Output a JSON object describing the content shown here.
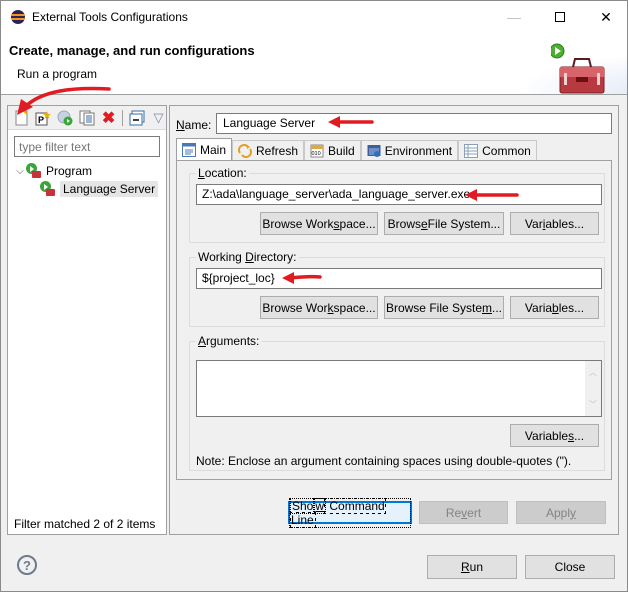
{
  "window": {
    "title": "External Tools Configurations",
    "controls": [
      "minimize",
      "maximize",
      "close"
    ]
  },
  "header": {
    "title": "Create, manage, and run configurations",
    "subtitle": "Run a program",
    "icon": "toolbox-run-icon"
  },
  "left_panel": {
    "toolbar": [
      {
        "name": "new-launch-configuration",
        "icon": "new-config-icon"
      },
      {
        "name": "new-prototype",
        "icon": "new-prototype-icon"
      },
      {
        "name": "export",
        "icon": "export-icon"
      },
      {
        "name": "duplicate",
        "icon": "duplicate-icon"
      },
      {
        "name": "delete",
        "icon": "delete-icon"
      },
      {
        "name": "collapse-all",
        "icon": "collapse-all-icon"
      },
      {
        "name": "filter",
        "icon": "filter-icon"
      }
    ],
    "filter_placeholder": "type filter text",
    "tree": {
      "category": "Program",
      "items": [
        "Language Server"
      ],
      "selected": "Language Server"
    },
    "status": "Filter matched 2 of 2 items"
  },
  "config": {
    "name_label_pre": "",
    "name_label_u": "N",
    "name_label_post": "ame:",
    "name_value": "Language Server",
    "tabs": [
      {
        "label": "Main",
        "icon": "main-tab-icon",
        "active": true
      },
      {
        "label": "Refresh",
        "icon": "refresh-icon",
        "active": false
      },
      {
        "label": "Build",
        "icon": "build-icon",
        "active": false
      },
      {
        "label": "Environment",
        "icon": "environment-icon",
        "active": false
      },
      {
        "label": "Common",
        "icon": "common-icon",
        "active": false
      }
    ],
    "location": {
      "label_u": "L",
      "label_post": "ocation:",
      "value": "Z:\\ada\\language_server\\ada_language_server.exe",
      "buttons": {
        "workspace": {
          "pre": "Browse Work",
          "u": "s",
          "post": "pace..."
        },
        "filesystem": {
          "pre": "Brows",
          "u": "e",
          "post": " File System..."
        },
        "variables": {
          "pre": "Var",
          "u": "i",
          "post": "ables..."
        }
      }
    },
    "working_directory": {
      "label_pre": "Working ",
      "label_u": "D",
      "label_post": "irectory:",
      "value": "${project_loc}",
      "buttons": {
        "workspace": {
          "pre": "Browse Wor",
          "u": "k",
          "post": "space..."
        },
        "filesystem": {
          "pre": "Browse File Syste",
          "u": "m",
          "post": "..."
        },
        "variables": {
          "pre": "Varia",
          "u": "b",
          "post": "les..."
        }
      }
    },
    "arguments": {
      "label_u": "A",
      "label_post": "rguments:",
      "value": "",
      "variables": {
        "pre": "Variable",
        "u": "s",
        "post": "..."
      },
      "note": "Note: Enclose an argument containing spaces using double-quotes (\")."
    },
    "actions": {
      "show_command_line": {
        "pre": "Sho",
        "u": "w",
        "post": " Command Line"
      },
      "revert": {
        "pre": "Re",
        "u": "v",
        "post": "ert",
        "enabled": false
      },
      "apply": {
        "pre": "Appl",
        "u": "y",
        "post": "",
        "enabled": false
      }
    }
  },
  "footer": {
    "help": "?",
    "run": {
      "pre": "",
      "u": "R",
      "post": "un"
    },
    "close": "Close"
  },
  "annotations": {
    "arrow_color": "#e11b22"
  }
}
